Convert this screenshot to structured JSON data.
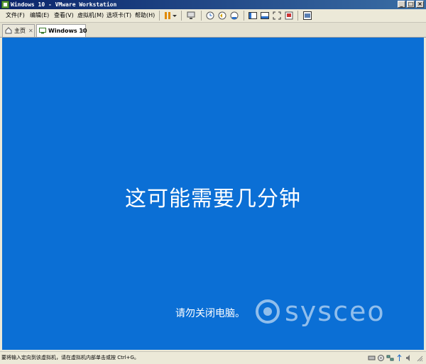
{
  "window": {
    "title": "Windows 10 - VMware Workstation"
  },
  "menu": [
    "文件(F)",
    "编辑(E)",
    "查看(V)",
    "虚拟机(M)",
    "选项卡(T)",
    "帮助(H)"
  ],
  "tabs": [
    {
      "label": "主页",
      "active": false
    },
    {
      "label": "Windows 10",
      "active": true
    }
  ],
  "vm": {
    "main_message": "这可能需要几分钟",
    "sub_message": "请勿关闭电脑。",
    "watermark": "sysceo"
  },
  "status": {
    "text": "要将输入定向到该虚拟机，请在虚拟机内部单击或按 Ctrl+G。"
  },
  "colors": {
    "vm_background": "#0b6fd5",
    "title_gradient_start": "#0a246a",
    "title_gradient_end": "#3a6ea5"
  }
}
